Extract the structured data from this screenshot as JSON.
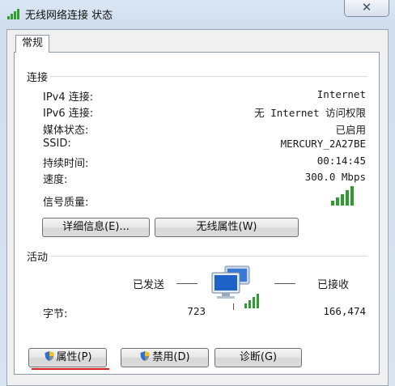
{
  "window": {
    "title": "无线网络连接 状态",
    "close_glyph": "✕"
  },
  "tabs": [
    {
      "label": "常规"
    }
  ],
  "connection": {
    "section_title": "连接",
    "rows": [
      {
        "label": "IPv4 连接:",
        "value": "Internet"
      },
      {
        "label": "IPv6 连接:",
        "value": "无 Internet 访问权限"
      },
      {
        "label": "媒体状态:",
        "value": "已启用"
      },
      {
        "label": "SSID:",
        "value": "MERCURY_2A27BE"
      },
      {
        "label": "持续时间:",
        "value": "00:14:45"
      },
      {
        "label": "速度:",
        "value": "300.0 Mbps"
      }
    ],
    "signal_label": "信号质量:",
    "signal_level": 1.0,
    "details_button": "详细信息(E)...",
    "wireless_props_button": "无线属性(W)"
  },
  "activity": {
    "section_title": "活动",
    "sent_label": "已发送",
    "received_label": "已接收",
    "bytes_label": "字节:",
    "bytes_sent": "723",
    "bytes_received": "166,474"
  },
  "buttons": {
    "properties": "属性(P)",
    "disable": "禁用(D)",
    "diagnose": "诊断(G)"
  },
  "colors": {
    "signal_green": "#2e9d2e",
    "highlight_underline": "#d62020",
    "monitor_blue": "#1f62c6"
  },
  "icons": {
    "title": "wireless-signal-icon",
    "shield": "uac-shield-icon",
    "network": "network-computers-icon"
  }
}
